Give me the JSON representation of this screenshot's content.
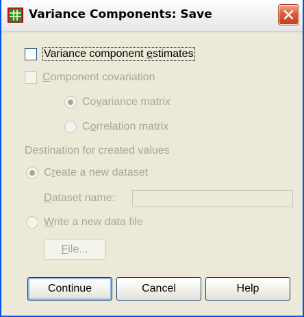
{
  "window": {
    "title": "Variance Components: Save",
    "close_icon": "close-icon",
    "app_icon": "spss-grid-icon"
  },
  "options": {
    "variance_estimates": {
      "label_pre": "Variance component ",
      "label_u": "e",
      "label_post": "stimates",
      "checked": false,
      "enabled": true
    },
    "component_covariation": {
      "label_u": "C",
      "label_post": "omponent covariation",
      "checked": false,
      "enabled": false
    },
    "covariance_matrix": {
      "label_pre": "Co",
      "label_u": "v",
      "label_post": "ariance matrix",
      "selected": true,
      "enabled": false
    },
    "correlation_matrix": {
      "label_pre": "C",
      "label_u": "o",
      "label_post": "rrelation matrix",
      "selected": false,
      "enabled": false
    }
  },
  "destination": {
    "heading": "Destination for created values",
    "create_dataset": {
      "label_pre": "C",
      "label_u": "r",
      "label_post": "eate a new dataset",
      "selected": true,
      "enabled": false
    },
    "dataset_name": {
      "label_u": "D",
      "label_post": "ataset name:",
      "value": ""
    },
    "write_file": {
      "label_u": "W",
      "label_post": "rite a new data file",
      "selected": false,
      "enabled": false
    },
    "file_button": {
      "label_u": "F",
      "label_post": "ile..."
    }
  },
  "buttons": {
    "continue": "Continue",
    "cancel": "Cancel",
    "help": "Help"
  },
  "colors": {
    "title_close_accent": "#e0593a",
    "disabled_text": "#a7a697",
    "window_bg": "#ece9d8"
  }
}
